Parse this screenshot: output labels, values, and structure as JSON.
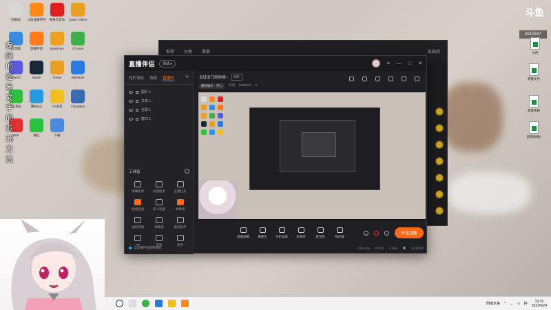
{
  "desktop": {
    "left_icons": [
      {
        "label": "回收站",
        "color": "#d8d8d8"
      },
      {
        "label": "斗鱼直播伴侣",
        "color": "#ff8a1a"
      },
      {
        "label": "网易云音乐",
        "color": "#e02020"
      },
      {
        "label": "Game Online",
        "color": "#e8a020"
      },
      {
        "label": "此电脑",
        "color": "#3a8ae0"
      },
      {
        "label": "直播伴侣",
        "color": "#ff7a1a"
      },
      {
        "label": "Bandicam",
        "color": "#f0a020"
      },
      {
        "label": "Chrome",
        "color": "#3cb04a"
      },
      {
        "label": "Live2D",
        "color": "#5a5ae0"
      },
      {
        "label": "Steam",
        "color": "#1b2838"
      },
      {
        "label": "Game",
        "color": "#e8a020"
      },
      {
        "label": "WeGame",
        "color": "#2a7ae0"
      },
      {
        "label": "QQ音乐",
        "color": "#30c040"
      },
      {
        "label": "腾讯QQ",
        "color": "#2a9ae0"
      },
      {
        "label": "YY语音",
        "color": "#f0c020"
      },
      {
        "label": "VirtualBox",
        "color": "#3a6ab0"
      },
      {
        "label": "PDF",
        "color": "#e03030"
      },
      {
        "label": "微信",
        "color": "#2ac040"
      },
      {
        "label": "下载",
        "color": "#4a8ae0"
      }
    ],
    "vertical_text": "保障的迹象文字的亚洲方法"
  },
  "back_window": {
    "tabs": [
      "推荐",
      "分类",
      "赛事"
    ],
    "user": "凯凯的"
  },
  "main_window": {
    "logo": "直播伴侣",
    "version_badge": "测试 ▸",
    "tabs": [
      "我的场景",
      "场景",
      "直播间"
    ],
    "sources": [
      {
        "label": "图片 1"
      },
      {
        "label": "文本 1"
      },
      {
        "label": "全屏 1"
      },
      {
        "label": "窗口 1"
      }
    ],
    "tools_title": "工具箱",
    "tools": [
      {
        "label": "弹幕助手",
        "orange": false
      },
      {
        "label": "房管助手",
        "orange": false
      },
      {
        "label": "主播任务",
        "orange": false
      },
      {
        "label": "视频连麦",
        "orange": true
      },
      {
        "label": "多人连麦",
        "orange": false
      },
      {
        "label": "弹幕墙",
        "orange": true
      },
      {
        "label": "虚拟形象",
        "orange": false
      },
      {
        "label": "弹幕卷",
        "orange": false
      },
      {
        "label": "歌词同步",
        "orange": false
      },
      {
        "label": "PK",
        "orange": false
      },
      {
        "label": "音效",
        "orange": false
      },
      {
        "label": "更多",
        "orange": false
      }
    ],
    "left_footer": "当直播伴侣使用教程",
    "stream_title": "见证出门的时候~",
    "edit_label": "修改",
    "category": "趣味娱乐 · 开心",
    "room_label": "房间",
    "room_id": "9210347",
    "viewers": "6",
    "controls": [
      {
        "label": "直播屏幕"
      },
      {
        "label": "摄像头"
      },
      {
        "label": "手机投屏"
      },
      {
        "label": "多媒体"
      },
      {
        "label": "麦克风"
      },
      {
        "label": "扬声器"
      }
    ],
    "start_button": "开始直播",
    "status": {
      "cpu": "CPU 0%",
      "fps": "FPS 0",
      "bitrate": "0 kb/s",
      "time": "00:00:00"
    }
  },
  "right_side": {
    "logo": "斗鱼",
    "room_number": "9210347",
    "doc_icons": [
      {
        "label": "文档"
      },
      {
        "label": "新建文件"
      },
      {
        "label": "新建表格"
      },
      {
        "label": "新建表格2"
      }
    ]
  },
  "taskbar": {
    "lang": "拼",
    "status_text": "阴雨未来",
    "time": "19:15",
    "date": "2022/6/24"
  }
}
